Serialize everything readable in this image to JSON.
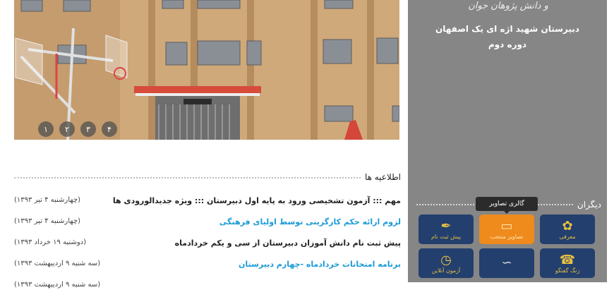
{
  "slider": {
    "dots": [
      "۱",
      "۲",
      "۳",
      "۴"
    ]
  },
  "news": {
    "title": "اطلاعیه ها",
    "items": [
      {
        "text": "مهم ::: آزمون تشخیصی ورود به پایه اول دبیرستان ::: ویژه جدیدالورودی ها",
        "date": "(چهارشنبه ۴ تیر ۱۳۹۳)",
        "link": false
      },
      {
        "text": "لزوم ارائه حکم کارگزینی توسط اولیای فرهنگی",
        "date": "(چهارشنبه ۴ تیر ۱۳۹۳)",
        "link": true
      },
      {
        "text": "پیش ثبت نام دانش آموزان دبیرستان از سی و یکم خردادماه",
        "date": "(دوشنبه ۱۹ خرداد ۱۳۹۳)",
        "link": false
      },
      {
        "text": "برنامه امتحانات خردادماه -چهارم دبیرستان",
        "date": "(سه شنبه ۹ اردیبهشت ۱۳۹۳)",
        "link": true
      },
      {
        "text": "",
        "date": "(سه شنبه ۹ اردیبهشت ۱۳۹۳)",
        "link": false
      }
    ]
  },
  "sidebar": {
    "logo_text": "و دانش پژوهان جوان",
    "school_name": "دبیرستان شهید اژه ای یک اصفهان",
    "course": "دوره دوم",
    "others_title": "دیگران",
    "tooltip": "گالری تصاویر",
    "tiles": [
      {
        "label": "پیش ثبت نام",
        "icon": "pen-icon"
      },
      {
        "label": "تصاویر منتخب",
        "icon": "gallery-icon"
      },
      {
        "label": "معرفی",
        "icon": "flower-icon"
      },
      {
        "label": "آزمون آنلاین",
        "icon": "clock-icon"
      },
      {
        "label": "",
        "icon": "calligraphy-icon"
      },
      {
        "label": "زنگ گفتگو",
        "icon": "chat-icon"
      }
    ]
  },
  "colors": {
    "sidebar_bg": "#868686",
    "tile_bg": "#233f6e",
    "tile_active": "#ef8a1d",
    "link": "#1a9ad6"
  }
}
